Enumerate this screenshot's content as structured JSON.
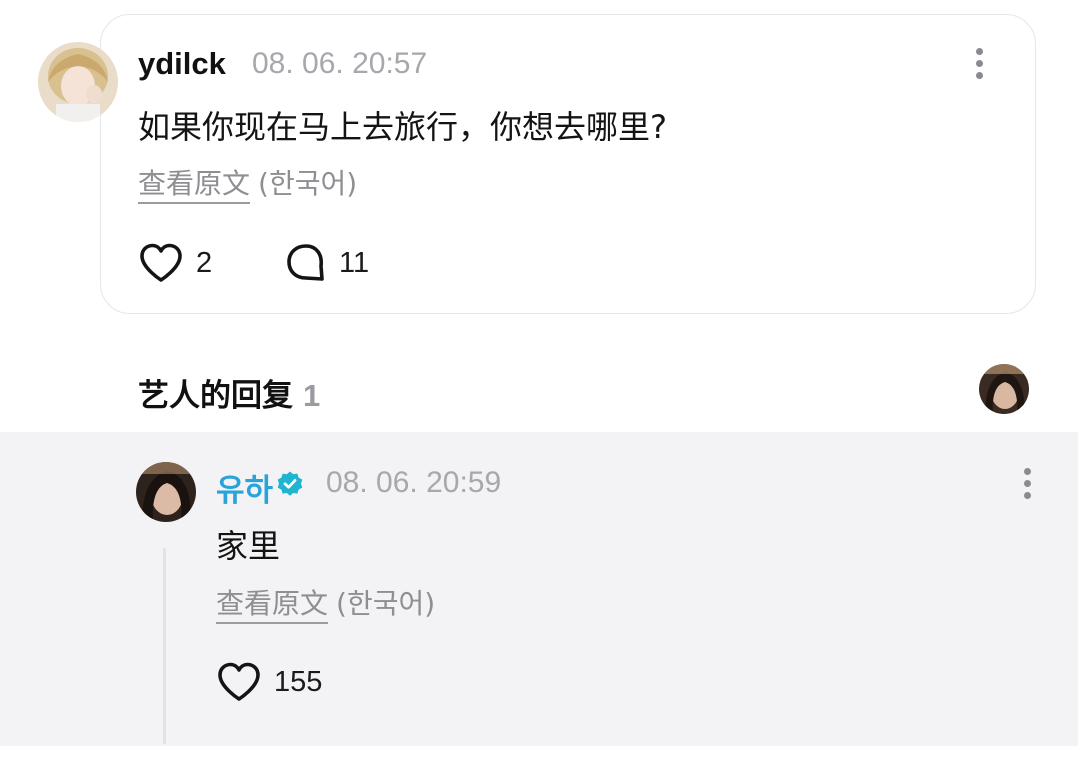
{
  "post": {
    "username": "ydilck",
    "timestamp": "08. 06. 20:57",
    "message": "如果你现在马上去旅行，你想去哪里?",
    "view_original": "查看原文",
    "language": "(한국어)",
    "like_count": "2",
    "comment_count": "11"
  },
  "section": {
    "title": "艺人的回复",
    "count": "1"
  },
  "reply": {
    "username": "유하",
    "timestamp": "08. 06. 20:59",
    "message": "家里",
    "view_original": "查看原文",
    "language": "(한국어)",
    "like_count": "155"
  },
  "colors": {
    "artist_name": "#2aa3d9",
    "verified_badge": "#1fb5cf",
    "reply_background": "#f3f3f6"
  },
  "icons": {
    "heart": "heart-icon",
    "comment": "comment-icon",
    "more": "more-options-icon",
    "verified": "verified-badge-icon"
  }
}
